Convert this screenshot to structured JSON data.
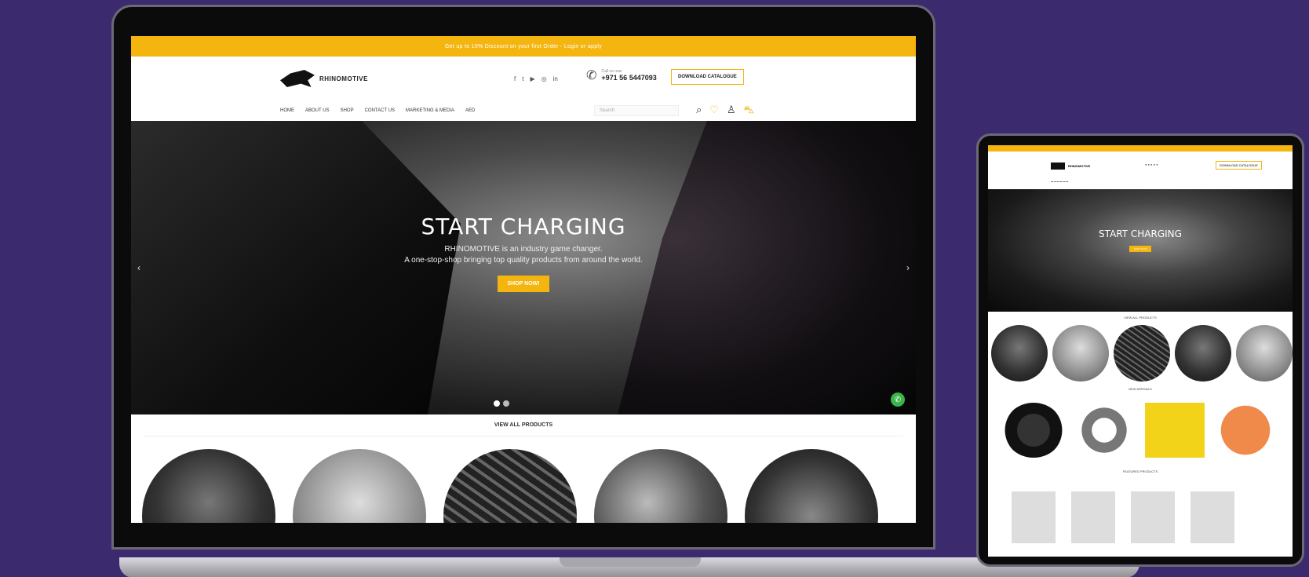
{
  "laptop": {
    "topbar": {
      "text": "Get up to 10% Discount on your first Order - Login or apply"
    },
    "header": {
      "logo_text": "RHINOMOTIVE",
      "social_icons": [
        "facebook-icon",
        "twitter-icon",
        "youtube-icon",
        "instagram-icon",
        "linkedin-icon"
      ],
      "phone_label": "Call us now",
      "phone_number": "+971 56 5447093",
      "catalogue_button": "DOWNLOAD CATALOGUE"
    },
    "nav": {
      "items": [
        "HOME",
        "ABOUT US",
        "SHOP",
        "CONTACT US",
        "MARKETING & MEDIA",
        "AED"
      ],
      "search_placeholder": "Search"
    },
    "hero": {
      "title": "START CHARGING",
      "subtitle_line1": "RHINOMOTIVE is an industry game changer.",
      "subtitle_line2": "A one-stop-shop bringing top quality products from around the world.",
      "button": "SHOP NOW!"
    },
    "section": {
      "title": "VIEW ALL PRODUCTS"
    }
  },
  "tablet": {
    "header": {
      "logo_text": "RHINOMOTIVE",
      "catalogue_button": "DOWNLOAD CATALOGUE"
    },
    "hero": {
      "title": "START CHARGING",
      "button": "SHOP NOW"
    },
    "section1_title": "VIEW ALL PRODUCTS",
    "section2_title": "NEW ARRIVALS",
    "section3_title": "FEATURED PRODUCTS"
  },
  "colors": {
    "background": "#3b2a6e",
    "accent": "#f5b50f",
    "whatsapp": "#3bb54a"
  }
}
